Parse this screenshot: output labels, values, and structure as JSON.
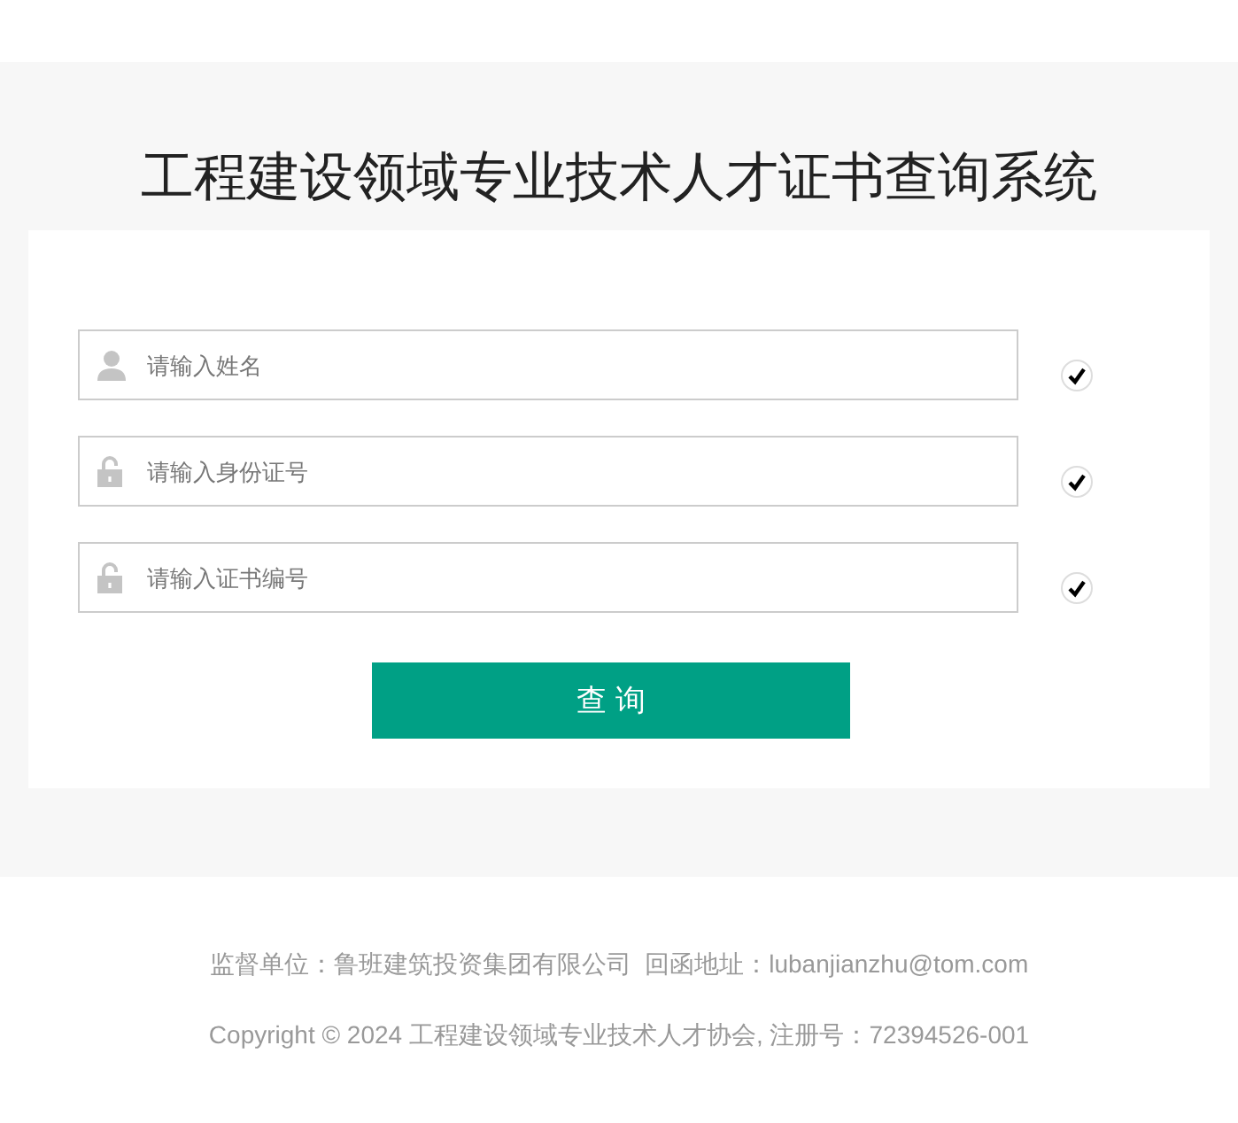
{
  "title": "工程建设领域专业技术人才证书查询系统",
  "fields": [
    {
      "kind": "person",
      "placeholder": "请输入姓名",
      "valid": true
    },
    {
      "kind": "lock",
      "placeholder": "请输入身份证号",
      "valid": true
    },
    {
      "kind": "lock",
      "placeholder": "请输入证书编号",
      "valid": true
    }
  ],
  "submit": "查 询",
  "footer": [
    "监督单位：鲁班建筑投资集团有限公司  回函地址：lubanjianzhu@tom.com",
    "Copyright © 2024 工程建设领域专业技术人才协会, 注册号：72394526-001"
  ]
}
